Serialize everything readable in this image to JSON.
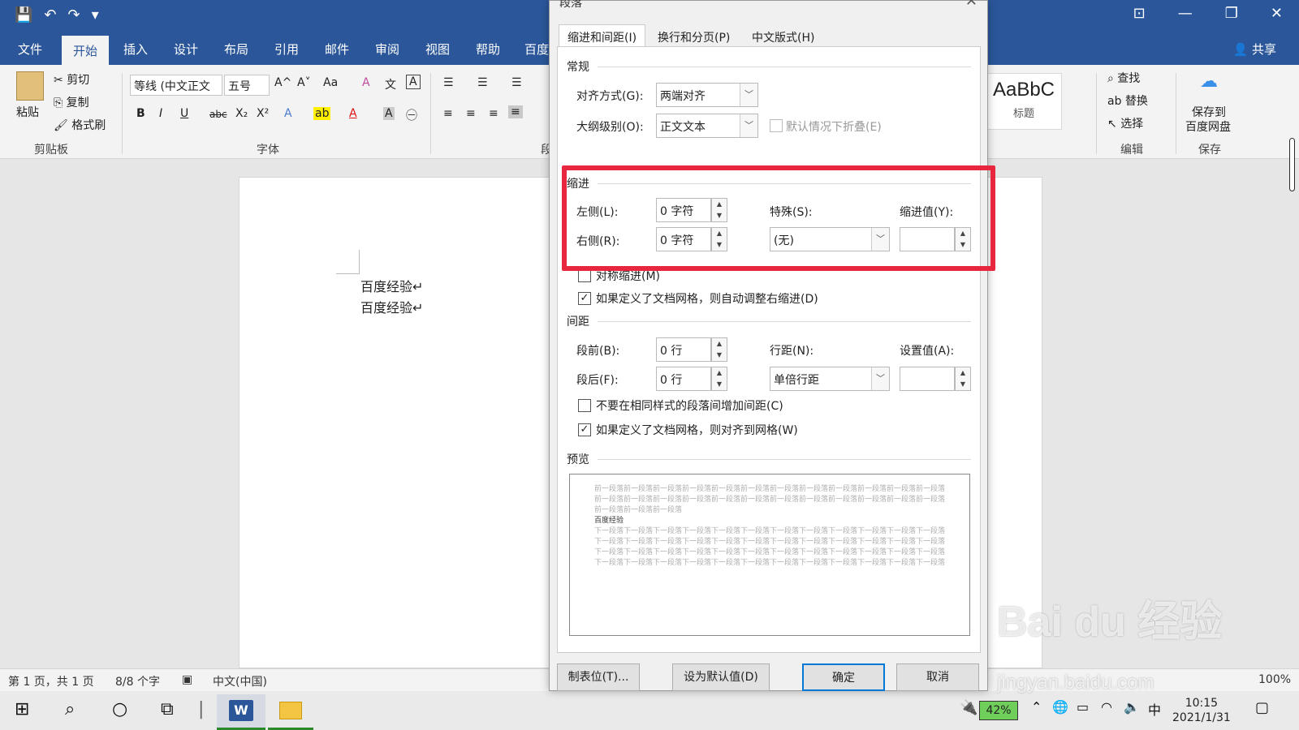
{
  "qat": {
    "save_icon": "💾",
    "undo_icon": "↶",
    "redo_icon": "↷",
    "more_icon": "▾"
  },
  "window_controls": {
    "ribbon_options": "⊡",
    "minimize": "—",
    "restore": "❐",
    "close": "✕"
  },
  "tabs": [
    "文件",
    "开始",
    "插入",
    "设计",
    "布局",
    "引用",
    "邮件",
    "审阅",
    "视图",
    "帮助",
    "百度"
  ],
  "share_label": "共享",
  "ribbon": {
    "clipboard": {
      "paste": "粘贴",
      "cut": "剪切",
      "copy": "复制",
      "format_painter": "格式刷",
      "group": "剪贴板"
    },
    "font": {
      "font_name": "等线 (中文正文",
      "font_size": "五号",
      "group": "字体",
      "bold": "B",
      "italic": "I",
      "underline": "U",
      "strike": "abc",
      "subscript": "X₂",
      "superscript": "X²",
      "grow": "A^",
      "shrink": "A˅",
      "case": "Aa"
    },
    "paragraph_group": "段",
    "styles": {
      "sample": "AaBbC",
      "name": "标题"
    },
    "editing": {
      "find": "查找",
      "replace": "替换",
      "select": "选择",
      "group": "编辑"
    },
    "save": {
      "line1": "保存到",
      "line2": "百度网盘",
      "group": "保存"
    }
  },
  "document": {
    "lines": [
      "百度经验↵",
      "百度经验↵"
    ]
  },
  "status": {
    "page": "第 1 页，共 1 页",
    "words": "8/8 个字",
    "lang": "中文(中国)",
    "zoom": "100%"
  },
  "taskbar": {
    "battery": "42%",
    "time": "10:15",
    "date": "2021/1/31",
    "ime": "中"
  },
  "dialog": {
    "title": "段落",
    "tabs": [
      "缩进和间距(I)",
      "换行和分页(P)",
      "中文版式(H)"
    ],
    "general": {
      "section": "常规",
      "alignment_label": "对齐方式(G):",
      "alignment_value": "两端对齐",
      "outline_label": "大纲级别(O):",
      "outline_value": "正文文本",
      "collapse_label": "默认情况下折叠(E)"
    },
    "indent": {
      "section": "缩进",
      "left_label": "左侧(L):",
      "left_value": "0 字符",
      "right_label": "右侧(R):",
      "right_value": "0 字符",
      "special_label": "特殊(S):",
      "special_value": "(无)",
      "by_label": "缩进值(Y):",
      "by_value": "",
      "mirror_label": "对称缩进(M)",
      "auto_adjust_label": "如果定义了文档网格，则自动调整右缩进(D)"
    },
    "spacing": {
      "section": "间距",
      "before_label": "段前(B):",
      "before_value": "0 行",
      "after_label": "段后(F):",
      "after_value": "0 行",
      "line_label": "行距(N):",
      "line_value": "单倍行距",
      "at_label": "设置值(A):",
      "at_value": "",
      "no_space_label": "不要在相同样式的段落间增加间距(C)",
      "snap_grid_label": "如果定义了文档网格，则对齐到网格(W)"
    },
    "preview": {
      "section": "预览",
      "prev_text": "前一段落前一段落前一段落前一段落前一段落前一段落前一段落前一段落前一段落前一段落前一段落前一段落前一段落前一段落前一段落前一段落前一段落前一段落前一段落前一段落前一段落前一段落前一段落前一段落前一段落前一段落前一段落",
      "current_text": "百度经验",
      "next_text": "下一段落下一段落下一段落下一段落下一段落下一段落下一段落下一段落下一段落下一段落下一段落下一段落下一段落下一段落下一段落下一段落下一段落下一段落下一段落下一段落下一段落下一段落下一段落下一段落下一段落下一段落下一段落下一段落下一段落下一段落下一段落下一段落下一段落下一段落下一段落下一段落下一段落下一段落下一段落下一段落下一段落下一段落下一段落下一段落下一段落下一段落下一段落下一段落"
    },
    "buttons": {
      "tabs": "制表位(T)...",
      "default": "设为默认值(D)",
      "ok": "确定",
      "cancel": "取消"
    }
  },
  "watermark": {
    "brand": "Bai du 经验",
    "url": "jingyan.baidu.com"
  },
  "colors": {
    "accent": "#2b579a",
    "highlight": "#e8273f"
  }
}
